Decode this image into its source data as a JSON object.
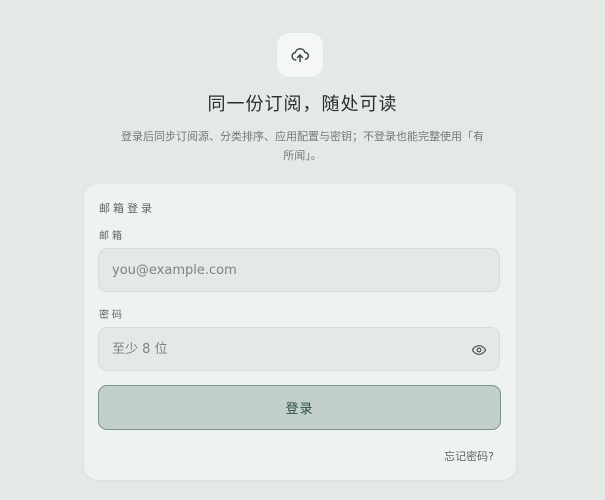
{
  "brand": {
    "icon": "cloud-upload-icon",
    "headline": "同一份订阅，随处可读",
    "subtext": "登录后同步订阅源、分类排序、应用配置与密钥；不登录也能完整使用「有所闻」。"
  },
  "login": {
    "section_title": "邮箱登录",
    "email_label": "邮箱",
    "email_placeholder": "you@example.com",
    "password_label": "密码",
    "password_placeholder": "至少 8 位",
    "toggle_icon": "eye-icon",
    "submit_label": "登录",
    "forgot_label": "忘记密码?"
  },
  "colors": {
    "background": "#e4e9e6",
    "card": "#eef3f0",
    "button_fill": "#c3cfcb",
    "button_text": "#2d4d46"
  }
}
